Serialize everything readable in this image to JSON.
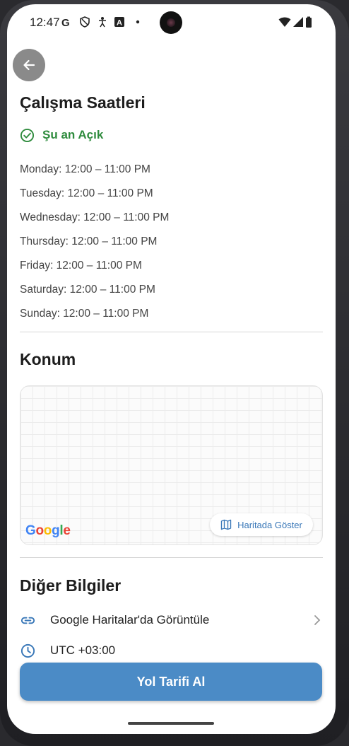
{
  "status_bar": {
    "time": "12:47",
    "icons": [
      "google-g-icon",
      "shield-icon",
      "accessibility-icon",
      "font-icon",
      "dot-icon",
      "wifi-icon",
      "signal-icon",
      "battery-icon"
    ]
  },
  "hours_section": {
    "title": "Çalışma Saatleri",
    "open_status": "Şu an Açık",
    "days": [
      "Monday: 12:00 – 11:00 PM",
      "Tuesday: 12:00 – 11:00 PM",
      "Wednesday: 12:00 – 11:00 PM",
      "Thursday: 12:00 – 11:00 PM",
      "Friday: 12:00 – 11:00 PM",
      "Saturday: 12:00 – 11:00 PM",
      "Sunday: 12:00 – 11:00 PM"
    ]
  },
  "location_section": {
    "title": "Konum",
    "google_logo": "Google",
    "map_button": "Haritada Göster"
  },
  "other_section": {
    "title": "Diğer Bilgiler",
    "maps_link": "Google Haritalar'da Görüntüle",
    "timezone": "UTC +03:00"
  },
  "primary_button": "Yol Tarifi Al",
  "colors": {
    "accent": "#4b8bc6",
    "open": "#2e8b3d",
    "link_blue": "#3a78b8"
  }
}
